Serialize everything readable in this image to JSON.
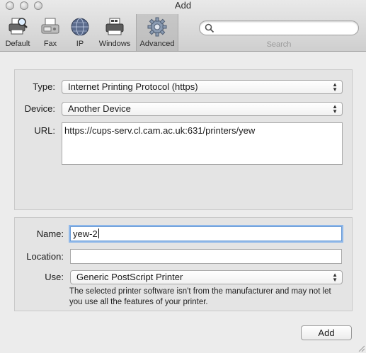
{
  "window": {
    "title": "Add"
  },
  "toolbar": {
    "items": [
      {
        "label": "Default",
        "icon": "printer-magnifier-icon"
      },
      {
        "label": "Fax",
        "icon": "fax-icon"
      },
      {
        "label": "IP",
        "icon": "globe-icon"
      },
      {
        "label": "Windows",
        "icon": "windows-printer-icon"
      },
      {
        "label": "Advanced",
        "icon": "gear-icon",
        "selected": true
      }
    ],
    "search": {
      "placeholder": "",
      "label": "Search"
    }
  },
  "connection": {
    "type_label": "Type:",
    "type_value": "Internet Printing Protocol (https)",
    "device_label": "Device:",
    "device_value": "Another Device",
    "url_label": "URL:",
    "url_value": "https://cups-serv.cl.cam.ac.uk:631/printers/yew"
  },
  "printer": {
    "name_label": "Name:",
    "name_value": "yew-2",
    "location_label": "Location:",
    "location_value": "",
    "use_label": "Use:",
    "use_value": "Generic PostScript Printer",
    "note": "The selected printer software isn't from the manufacturer and may not let you use all the features of your printer."
  },
  "actions": {
    "add_label": "Add"
  }
}
